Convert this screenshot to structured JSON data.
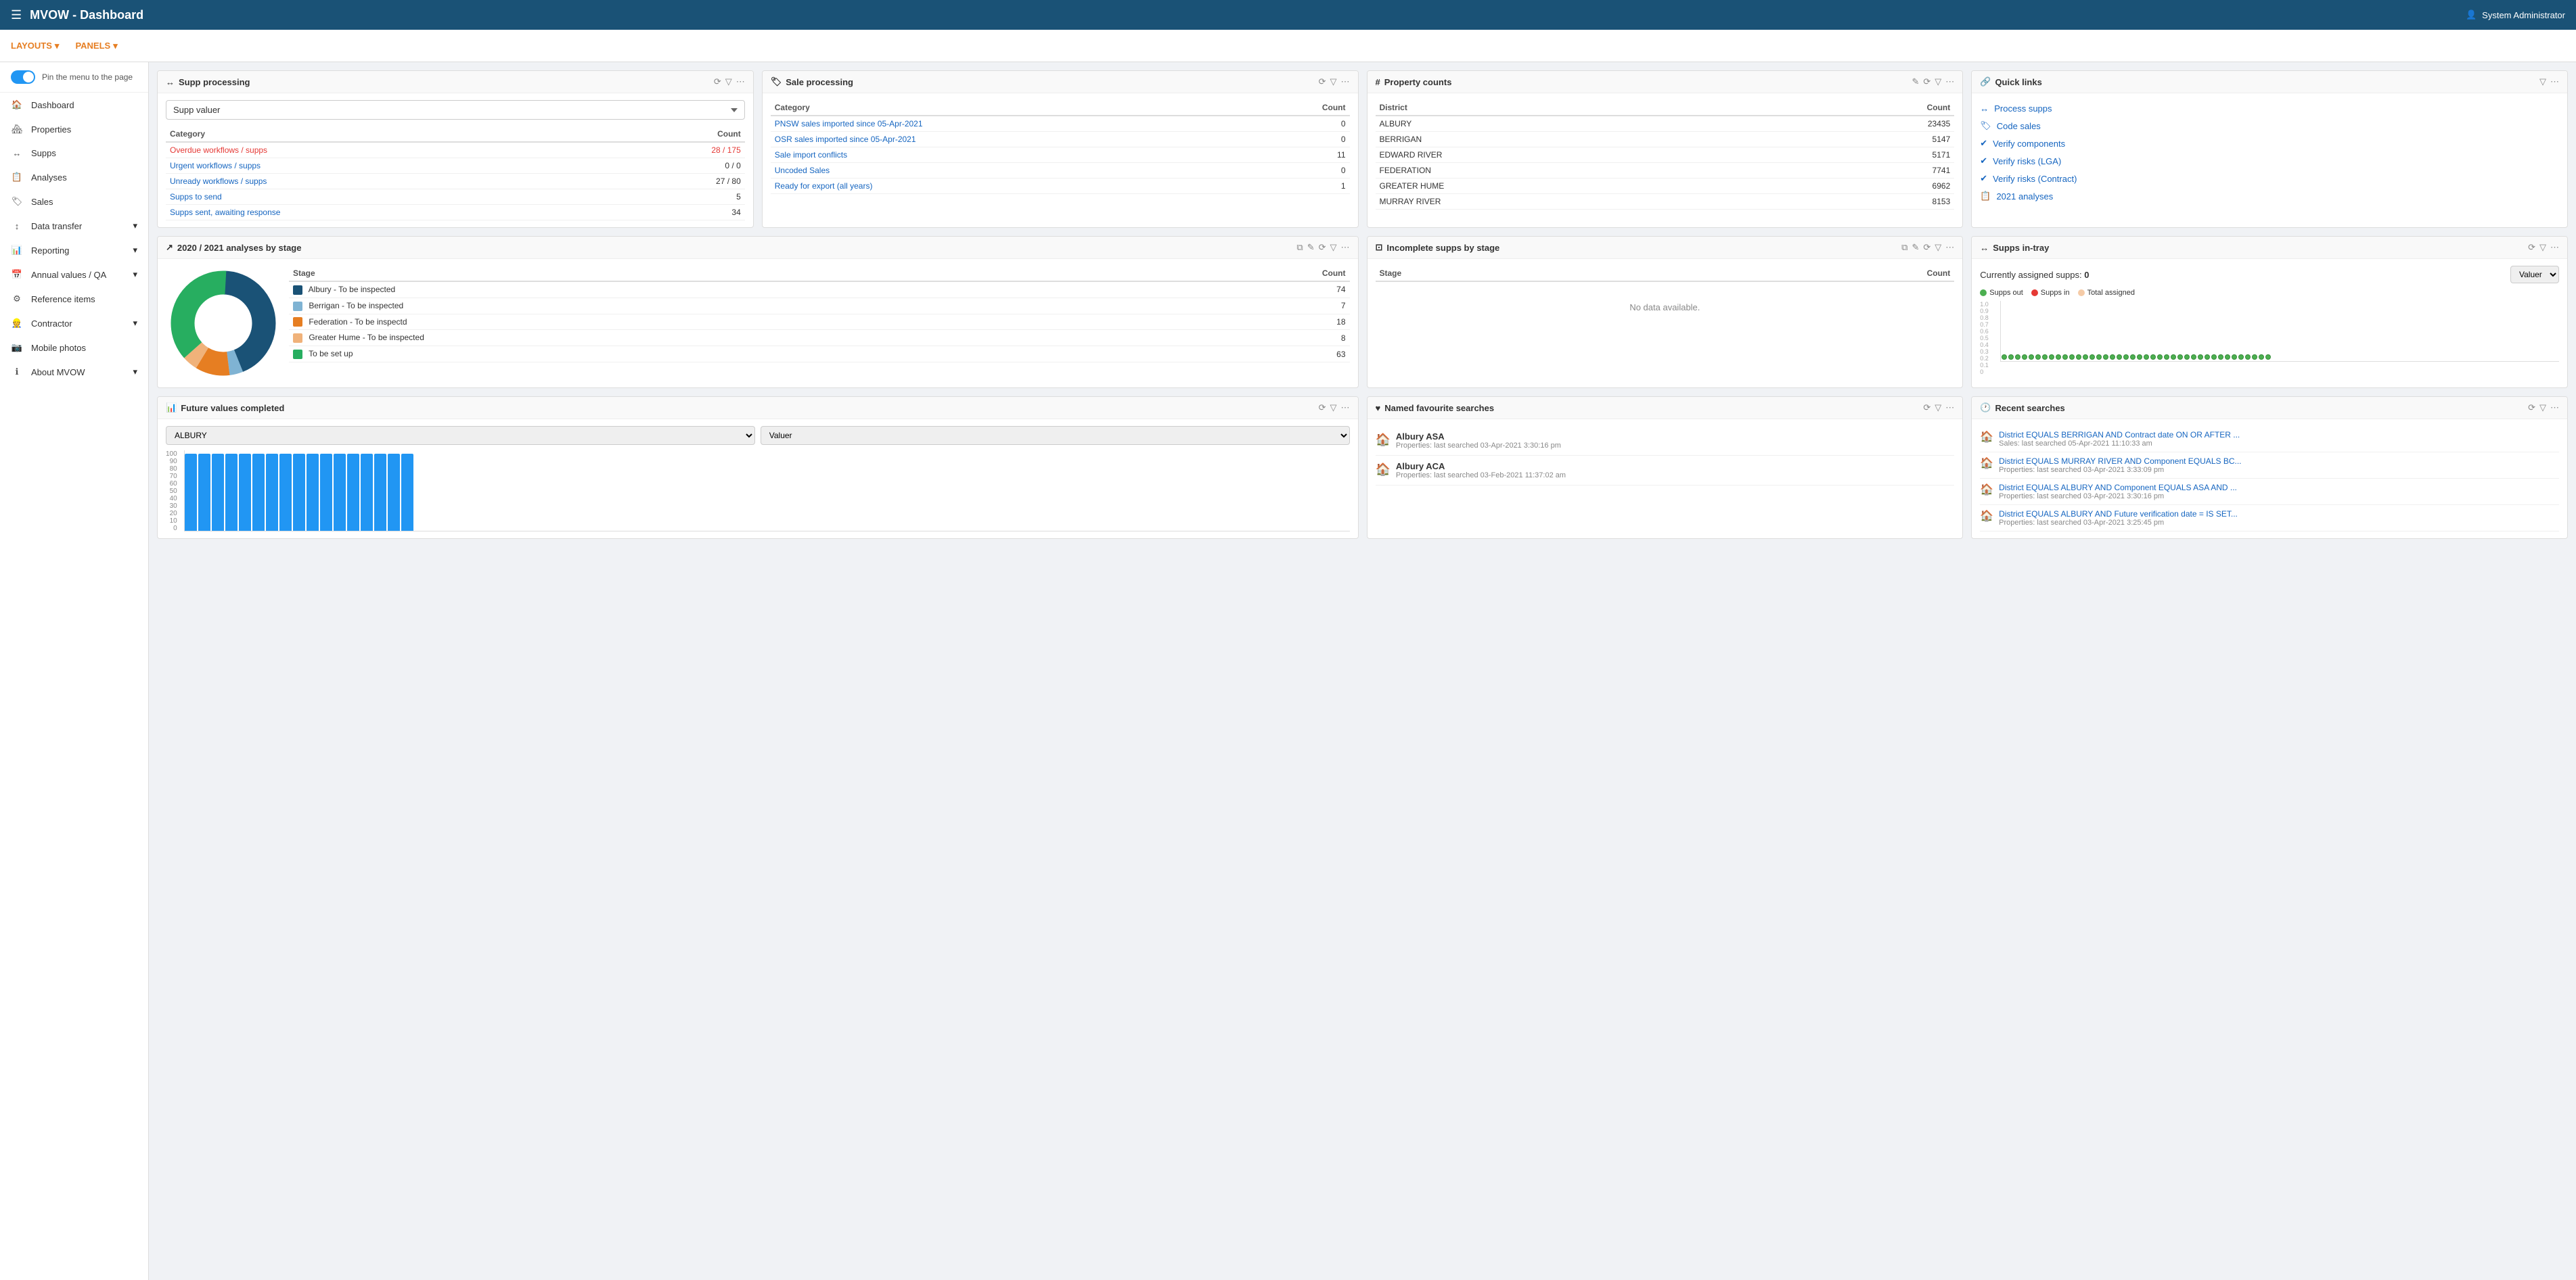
{
  "app": {
    "title": "MVOW - Dashboard",
    "user": "System Administrator"
  },
  "subnav": {
    "layouts_label": "LAYOUTS",
    "panels_label": "PANELS"
  },
  "sidebar": {
    "toggle_label": "Pin the menu to the page",
    "items": [
      {
        "id": "dashboard",
        "label": "Dashboard",
        "icon": "🏠",
        "has_arrow": false
      },
      {
        "id": "properties",
        "label": "Properties",
        "icon": "🏘",
        "has_arrow": false
      },
      {
        "id": "supps",
        "label": "Supps",
        "icon": "↔",
        "has_arrow": false
      },
      {
        "id": "analyses",
        "label": "Analyses",
        "icon": "📋",
        "has_arrow": false
      },
      {
        "id": "sales",
        "label": "Sales",
        "icon": "🏷",
        "has_arrow": false
      },
      {
        "id": "data-transfer",
        "label": "Data transfer",
        "icon": "↕",
        "has_arrow": true
      },
      {
        "id": "reporting",
        "label": "Reporting",
        "icon": "📊",
        "has_arrow": true
      },
      {
        "id": "annual-values",
        "label": "Annual values / QA",
        "icon": "📅",
        "has_arrow": true
      },
      {
        "id": "reference-items",
        "label": "Reference items",
        "icon": "⚙",
        "has_arrow": false
      },
      {
        "id": "contractor",
        "label": "Contractor",
        "icon": "👷",
        "has_arrow": true
      },
      {
        "id": "mobile-photos",
        "label": "Mobile photos",
        "icon": "📷",
        "has_arrow": false
      },
      {
        "id": "about",
        "label": "About MVOW",
        "icon": "ℹ",
        "has_arrow": true
      }
    ]
  },
  "panels": {
    "supp_processing": {
      "title": "Supp processing",
      "dropdown_value": "Supp valuer",
      "columns": [
        "Category",
        "Count"
      ],
      "rows": [
        {
          "label": "Overdue workflows / supps",
          "value": "28 / 175",
          "is_red": true,
          "is_link": true
        },
        {
          "label": "Urgent workflows / supps",
          "value": "0 / 0",
          "is_red": false,
          "is_link": true
        },
        {
          "label": "Unready workflows / supps",
          "value": "27 / 80",
          "is_red": false,
          "is_link": true
        },
        {
          "label": "Supps to send",
          "value": "5",
          "is_red": false,
          "is_link": true
        },
        {
          "label": "Supps sent, awaiting response",
          "value": "34",
          "is_red": false,
          "is_link": true
        }
      ]
    },
    "sale_processing": {
      "title": "Sale processing",
      "columns": [
        "Category",
        "Count"
      ],
      "rows": [
        {
          "label": "PNSW sales imported since 05-Apr-2021",
          "value": "0",
          "is_link": true
        },
        {
          "label": "OSR sales imported since 05-Apr-2021",
          "value": "0",
          "is_link": true
        },
        {
          "label": "Sale import conflicts",
          "value": "11",
          "is_link": true
        },
        {
          "label": "Uncoded Sales",
          "value": "0",
          "is_link": true
        },
        {
          "label": "Ready for export (all years)",
          "value": "1",
          "is_link": true
        }
      ]
    },
    "property_counts": {
      "title": "Property counts",
      "columns": [
        "District",
        "Count"
      ],
      "rows": [
        {
          "label": "ALBURY",
          "value": "23435"
        },
        {
          "label": "BERRIGAN",
          "value": "5147"
        },
        {
          "label": "EDWARD RIVER",
          "value": "5171"
        },
        {
          "label": "FEDERATION",
          "value": "7741"
        },
        {
          "label": "GREATER HUME",
          "value": "6962"
        },
        {
          "label": "MURRAY RIVER",
          "value": "8153"
        }
      ]
    },
    "quick_links": {
      "title": "Quick links",
      "items": [
        {
          "label": "Process supps",
          "icon": "↔"
        },
        {
          "label": "Code sales",
          "icon": "🏷"
        },
        {
          "label": "Verify components",
          "icon": "✔"
        },
        {
          "label": "Verify risks (LGA)",
          "icon": "✔"
        },
        {
          "label": "Verify risks (Contract)",
          "icon": "✔"
        },
        {
          "label": "2021 analyses",
          "icon": "📋"
        }
      ]
    },
    "analyses_2020": {
      "title": "2020 / 2021 analyses by stage",
      "stages": [
        {
          "label": "Albury - To be inspected",
          "count": 74,
          "color": "#1a5276"
        },
        {
          "label": "Berrigan - To be inspected",
          "count": 7,
          "color": "#7fb3d3"
        },
        {
          "label": "Federation - To be inspectd",
          "count": 18,
          "color": "#e67e22"
        },
        {
          "label": "Greater Hume - To be inspected",
          "count": 8,
          "color": "#f0b27a"
        },
        {
          "label": "To be set up",
          "count": 63,
          "color": "#27ae60"
        }
      ]
    },
    "incomplete_supps": {
      "title": "Incomplete supps by stage",
      "columns": [
        "Stage",
        "Count"
      ],
      "no_data": "No data available."
    },
    "supps_intray": {
      "title": "Supps in-tray",
      "assigned_label": "Currently assigned supps:",
      "assigned_count": "0",
      "valuer_label": "Valuer",
      "legend": [
        {
          "label": "Supps out",
          "color": "#4caf50"
        },
        {
          "label": "Supps in",
          "color": "#e53935"
        },
        {
          "label": "Total assigned",
          "color": "#f5cba7"
        }
      ],
      "y_axis": [
        "1.0",
        "0.9",
        "0.8",
        "0.7",
        "0.6",
        "0.5",
        "0.4",
        "0.3",
        "0.2",
        "0.1",
        "0"
      ]
    },
    "future_values": {
      "title": "Future values completed",
      "district": "ALBURY",
      "valuer": "Valuer",
      "y_axis": [
        "100",
        "90",
        "80",
        "70",
        "60",
        "50",
        "40",
        "30",
        "20",
        "10",
        "0"
      ],
      "bar_values": [
        95,
        95,
        95,
        95,
        95,
        95,
        95,
        95,
        95,
        95,
        95,
        95,
        95,
        95,
        95,
        95,
        95
      ]
    },
    "named_searches": {
      "title": "Named favourite searches",
      "items": [
        {
          "name": "Albury ASA",
          "sub": "Properties: last searched 03-Apr-2021 3:30:16 pm"
        },
        {
          "name": "Albury ACA",
          "sub": "Properties: last searched 03-Feb-2021 11:37:02 am"
        }
      ]
    },
    "recent_searches": {
      "title": "Recent searches",
      "items": [
        {
          "text": "District EQUALS BERRIGAN AND Contract date ON OR AFTER ...",
          "sub": "Sales: last searched 05-Apr-2021 11:10:33 am"
        },
        {
          "text": "District EQUALS MURRAY RIVER AND Component EQUALS BC...",
          "sub": "Properties: last searched 03-Apr-2021 3:33:09 pm"
        },
        {
          "text": "District EQUALS ALBURY AND Component EQUALS ASA AND ...",
          "sub": "Properties: last searched 03-Apr-2021 3:30:16 pm"
        },
        {
          "text": "District EQUALS ALBURY AND Future verification date = IS SET...",
          "sub": "Properties: last searched 03-Apr-2021 3:25:45 pm"
        }
      ]
    }
  }
}
